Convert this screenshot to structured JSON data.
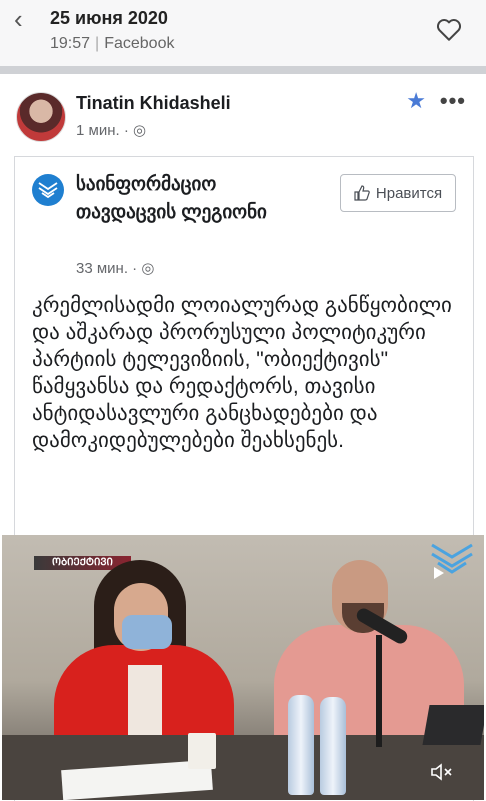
{
  "header": {
    "date": "25 июня 2020",
    "time": "19:57",
    "source": "Facebook"
  },
  "post": {
    "author": "Tinatin Khidasheli",
    "time": "1 мин."
  },
  "shared": {
    "page_name": "საინფორმაციო თავდაცვის ლეგიონი",
    "time": "33 мин.",
    "like_label": "Нравится",
    "text": "კრემლისადმი ლოიალურად განწყობილი და აშკარად პრორუსული პოლიტიკური პარტიის ტელევიზიის, \"ობიექტივის\" წამყვანსა და რედაქტორს, თავისი ანტიდასავლური განცხადებები და დამოკიდებულებები შეახსენეს."
  },
  "video": {
    "tag": "ᲝᲑᲘᲔᲥᲢᲘᲕᲘ",
    "muted": true
  },
  "colors": {
    "accent": "#4a7bd6",
    "page_logo": "#1f7fd0"
  },
  "icons": [
    "back-icon",
    "heart-icon",
    "star-icon",
    "more-icon",
    "globe-icon",
    "thumbs-up-icon",
    "mute-icon"
  ]
}
